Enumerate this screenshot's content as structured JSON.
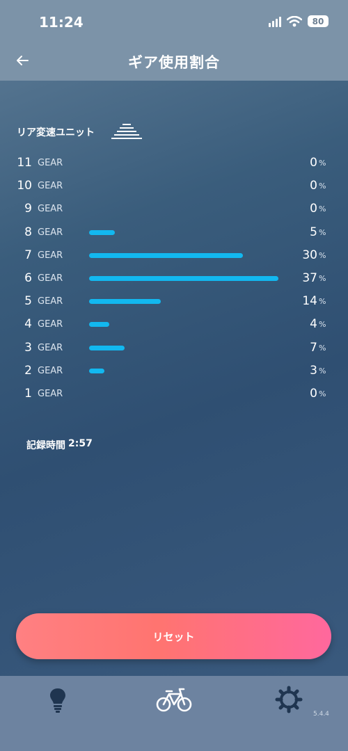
{
  "status_bar": {
    "time": "11:24",
    "battery": "80"
  },
  "header": {
    "title": "ギア使用割合"
  },
  "unit": {
    "label": "リア変速ユニット"
  },
  "gear_suffix": "GEAR",
  "percent_sign": "%",
  "gears": [
    {
      "num": "11",
      "value": "0",
      "ratio": 0
    },
    {
      "num": "10",
      "value": "0",
      "ratio": 0
    },
    {
      "num": "9",
      "value": "0",
      "ratio": 0
    },
    {
      "num": "8",
      "value": "5",
      "ratio": 0.05
    },
    {
      "num": "7",
      "value": "30",
      "ratio": 0.3
    },
    {
      "num": "6",
      "value": "37",
      "ratio": 0.37
    },
    {
      "num": "5",
      "value": "14",
      "ratio": 0.14
    },
    {
      "num": "4",
      "value": "4",
      "ratio": 0.04
    },
    {
      "num": "3",
      "value": "7",
      "ratio": 0.07
    },
    {
      "num": "2",
      "value": "3",
      "ratio": 0.03
    },
    {
      "num": "1",
      "value": "0",
      "ratio": 0
    }
  ],
  "record": {
    "label": "記録時間",
    "value": "2:57"
  },
  "reset_button": {
    "label": "リセット"
  },
  "tabs": [
    {
      "icon": "bulb-icon"
    },
    {
      "icon": "bicycle-icon"
    },
    {
      "icon": "settings-gear-icon"
    }
  ],
  "version": "5.4.4",
  "colors": {
    "bar": "#12b8f0",
    "button_start": "#ff8082",
    "button_end": "#ff689d"
  }
}
